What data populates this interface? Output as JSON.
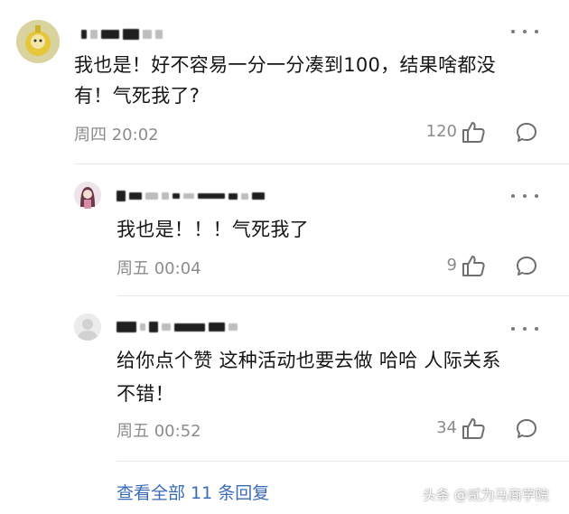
{
  "comments": [
    {
      "text": "我也是！好不容易一分一分凑到100，结果啥都没有！气死我了?",
      "line1": "我也是！好不容易一分一分凑到100，结果啥都没",
      "line2": "有！气死我了?",
      "time": "周四 20:02",
      "likes": "120"
    }
  ],
  "replies": [
    {
      "text": "我也是！！！气死我了",
      "time": "周五 00:04",
      "likes": "9"
    },
    {
      "line1": "给你点个赞 这种活动也要去做 哈哈 人际关系",
      "line2": "不错！",
      "time": "周五 00:52",
      "likes": "34"
    }
  ],
  "view_all": "查看全部 11 条回复",
  "watermark": "头条 @贰为马商学院",
  "colors": {
    "link": "#3a6bb8",
    "meta": "#8c8c8c",
    "text": "#161616"
  },
  "icons": [
    "more-icon",
    "thumbs-up-icon",
    "comment-bubble-icon"
  ]
}
